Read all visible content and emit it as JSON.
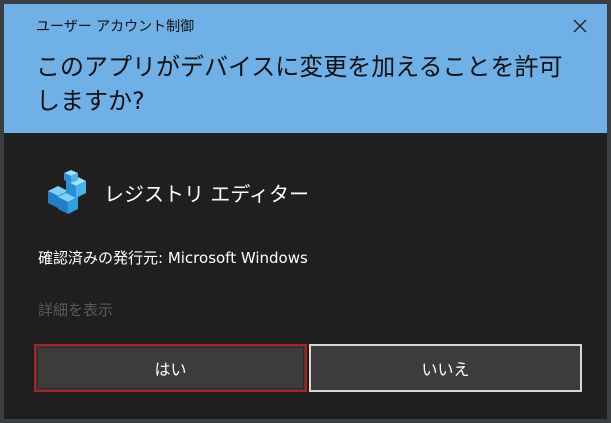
{
  "window": {
    "title": "ユーザー アカウント制御",
    "question": "このアプリがデバイスに変更を加えることを許可しますか?"
  },
  "app": {
    "name": "レジストリ エディター",
    "icon": "registry-editor-icon"
  },
  "publisher_text": "確認済みの発行元: Microsoft Windows",
  "details_link": "詳細を表示",
  "buttons": {
    "yes": "はい",
    "no": "いいえ"
  },
  "colors": {
    "header": "#6fb0e6",
    "body": "#1f1f1f",
    "focus_border": "#b51e1e"
  }
}
